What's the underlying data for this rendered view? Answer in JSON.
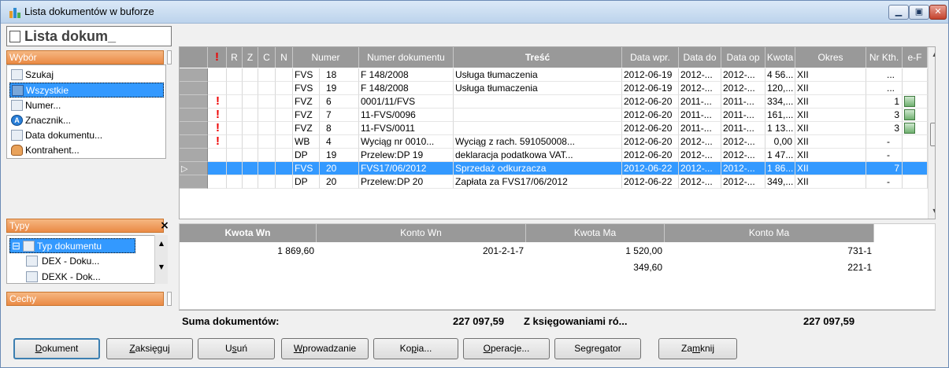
{
  "window": {
    "title": "Lista dokumentów w buforze"
  },
  "left": {
    "title": "Lista dokum_",
    "wybor": {
      "header": "Wybór",
      "items": [
        {
          "label": "Szukaj",
          "icon": "search-binoculars-icon",
          "selected": false
        },
        {
          "label": "Wszystkie",
          "icon": "table-icon",
          "selected": true
        },
        {
          "label": "Numer...",
          "icon": "table-icon",
          "selected": false
        },
        {
          "label": "Znacznik...",
          "icon": "tag-icon",
          "selected": false
        },
        {
          "label": "Data dokumentu...",
          "icon": "table-icon",
          "selected": false
        },
        {
          "label": "Kontrahent...",
          "icon": "people-icon",
          "selected": false
        }
      ]
    },
    "typy": {
      "header": "Typy",
      "close": "×",
      "items": [
        {
          "label": "Typ dokumentu",
          "expander": "⊟",
          "selected": true
        },
        {
          "label": "DEX - Doku...",
          "selected": false
        },
        {
          "label": "DEXK - Dok...",
          "selected": false
        }
      ]
    },
    "cechy": {
      "header": "Cechy"
    }
  },
  "grid": {
    "columns": [
      "!",
      "R",
      "Z",
      "C",
      "N",
      "Numer",
      "Numer dokumentu",
      "Treść",
      "Data wpr.",
      "Data do",
      "Data op",
      "Kwota",
      "Okres",
      "Nr Kth.",
      "e-F"
    ],
    "rows": [
      {
        "flag": "",
        "typ": "FVS",
        "nr": "18",
        "numer_dok": "F 148/2008",
        "tresc": "Usługa tłumaczenia",
        "data_wpr": "2012-06-19",
        "data_do": "2012-...",
        "data_op": "2012-...",
        "kwota": "4 56...",
        "okres": "XII",
        "nr_kth": "...",
        "ef": false,
        "selected": false
      },
      {
        "flag": "",
        "typ": "FVS",
        "nr": "19",
        "numer_dok": "F 148/2008",
        "tresc": "Usługa tłumaczenia",
        "data_wpr": "2012-06-19",
        "data_do": "2012-...",
        "data_op": "2012-...",
        "kwota": "120,...",
        "okres": "XII",
        "nr_kth": "...",
        "ef": false,
        "selected": false
      },
      {
        "flag": "!",
        "typ": "FVZ",
        "nr": "6",
        "numer_dok": "0001/11/FVS",
        "tresc": "",
        "data_wpr": "2012-06-20",
        "data_do": "2011-...",
        "data_op": "2011-...",
        "kwota": "334,...",
        "okres": "XII",
        "nr_kth": "1",
        "ef": true,
        "selected": false
      },
      {
        "flag": "!",
        "typ": "FVZ",
        "nr": "7",
        "numer_dok": "11-FVS/0096",
        "tresc": "",
        "data_wpr": "2012-06-20",
        "data_do": "2011-...",
        "data_op": "2011-...",
        "kwota": "161,...",
        "okres": "XII",
        "nr_kth": "3",
        "ef": true,
        "selected": false
      },
      {
        "flag": "!",
        "typ": "FVZ",
        "nr": "8",
        "numer_dok": "11-FVS/0011",
        "tresc": "",
        "data_wpr": "2012-06-20",
        "data_do": "2011-...",
        "data_op": "2011-...",
        "kwota": "1 13...",
        "okres": "XII",
        "nr_kth": "3",
        "ef": true,
        "selected": false
      },
      {
        "flag": "!",
        "typ": "WB",
        "nr": "4",
        "numer_dok": "Wyciąg nr 0010...",
        "tresc": "Wyciąg z rach. 591050008...",
        "data_wpr": "2012-06-20",
        "data_do": "2012-...",
        "data_op": "2012-...",
        "kwota": "0,00",
        "okres": "XII",
        "nr_kth": "-",
        "ef": false,
        "selected": false
      },
      {
        "flag": "",
        "typ": "DP",
        "nr": "19",
        "numer_dok": "Przelew:DP 19",
        "tresc": "deklaracja podatkowa VAT...",
        "data_wpr": "2012-06-20",
        "data_do": "2012-...",
        "data_op": "2012-...",
        "kwota": "1 47...",
        "okres": "XII",
        "nr_kth": "-",
        "ef": false,
        "selected": false
      },
      {
        "flag": "",
        "typ": "FVS",
        "nr": "20",
        "numer_dok": "FVS17/06/2012",
        "tresc": "Sprzedaż odkurzacza",
        "data_wpr": "2012-06-22",
        "data_do": "2012-...",
        "data_op": "2012-...",
        "kwota": "1 86...",
        "okres": "XII",
        "nr_kth": "7",
        "ef": false,
        "selected": true
      },
      {
        "flag": "",
        "typ": "DP",
        "nr": "20",
        "numer_dok": "Przelew:DP 20",
        "tresc": "Zapłata za FVS17/06/2012",
        "data_wpr": "2012-06-22",
        "data_do": "2012-...",
        "data_op": "2012-...",
        "kwota": "349,...",
        "okres": "XII",
        "nr_kth": "-",
        "ef": false,
        "selected": false
      }
    ]
  },
  "postings": {
    "headers": [
      "Kwota Wn",
      "Konto Wn",
      "Kwota Ma",
      "Konto Ma"
    ],
    "rows": [
      {
        "kwota_wn": "1 869,60",
        "konto_wn": "201-2-1-7",
        "kwota_ma": "1 520,00",
        "konto_ma": "731-1"
      },
      {
        "kwota_wn": "",
        "konto_wn": "",
        "kwota_ma": "349,60",
        "konto_ma": "221-1"
      }
    ]
  },
  "summary": {
    "label": "Suma dokumentów:",
    "value1": "227 097,59",
    "label2": "Z księgowaniami ró...",
    "value2": "227 097,59"
  },
  "buttons": [
    {
      "key": "D",
      "rest": "okument",
      "pre": ""
    },
    {
      "key": "Z",
      "rest": "aksięguj",
      "pre": ""
    },
    {
      "key": "s",
      "rest": "uń",
      "pre": "U"
    },
    {
      "key": "W",
      "rest": "prowadzanie",
      "pre": ""
    },
    {
      "key": "p",
      "rest": "ia...",
      "pre": "Ko"
    },
    {
      "key": "O",
      "rest": "peracje...",
      "pre": ""
    },
    {
      "key": "g",
      "rest": "regator",
      "pre": "Se"
    },
    {
      "key": "m",
      "rest": "knij",
      "pre": "Za"
    }
  ]
}
